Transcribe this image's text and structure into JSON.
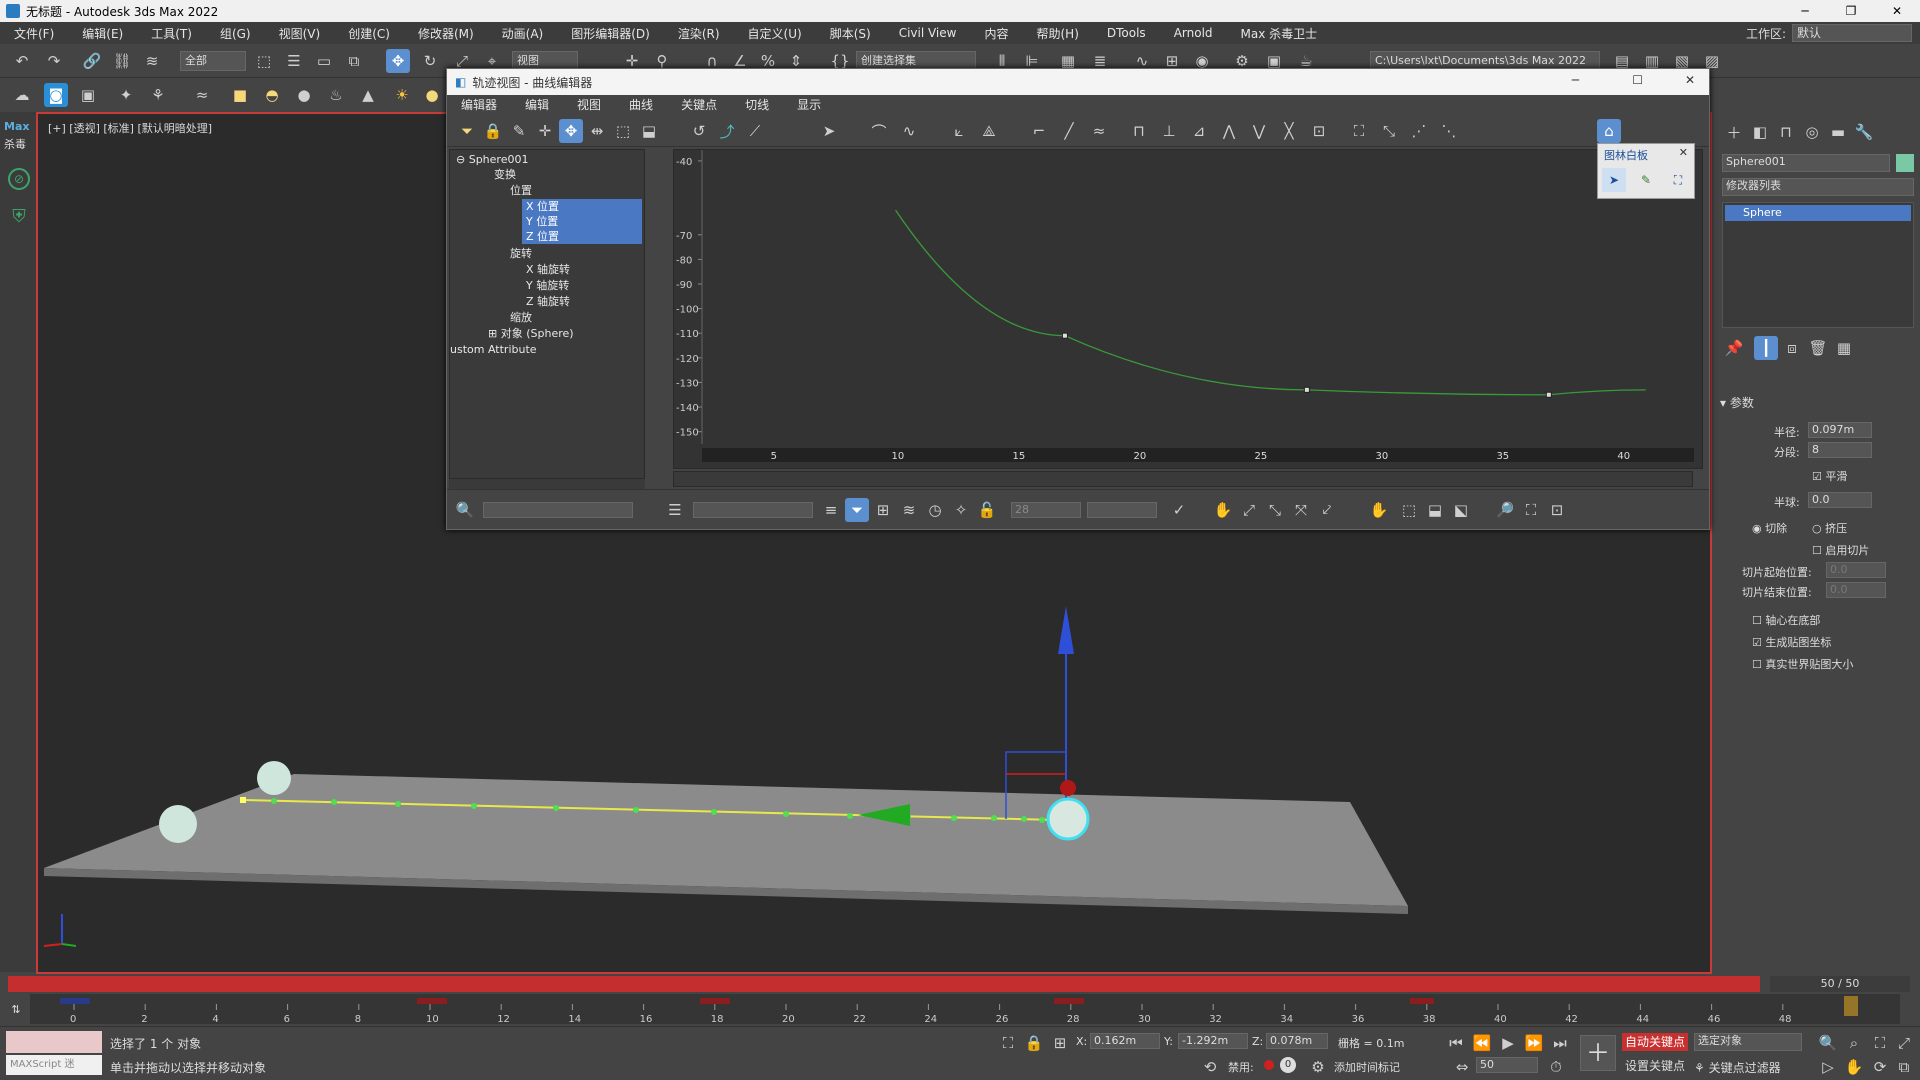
{
  "app": {
    "title": "无标题 - Autodesk 3ds Max 2022",
    "window_controls": [
      "─",
      "❐",
      "✕"
    ]
  },
  "menu": [
    "文件(F)",
    "编辑(E)",
    "工具(T)",
    "组(G)",
    "视图(V)",
    "创建(C)",
    "修改器(M)",
    "动画(A)",
    "图形编辑器(D)",
    "渲染(R)",
    "自定义(U)",
    "脚本(S)",
    "Civil View",
    "内容",
    "帮助(H)",
    "DTools",
    "Arnold",
    "Max 杀毒卫士"
  ],
  "workspace": {
    "label": "工作区:",
    "value": "默认"
  },
  "toolbar": {
    "selection_filter": "全部",
    "ref_coord": "视图",
    "named_selection": "创建选择集",
    "path": "C:\\Users\\lxt\\Documents\\3ds Max 2022"
  },
  "left_strip": {
    "logo_top": "Max",
    "logo_bottom": "杀毒"
  },
  "viewport": {
    "label": "[+] [透视] [标准] [默认明暗处理]",
    "axis_z": "z"
  },
  "trackview": {
    "title": "轨迹视图 - 曲线编辑器",
    "controls": [
      "─",
      "☐",
      "✕"
    ],
    "menu": [
      "编辑器",
      "编辑",
      "视图",
      "曲线",
      "关键点",
      "切线",
      "显示"
    ],
    "tree": {
      "root": "Sphere001",
      "transform": "变换",
      "position": "位置",
      "x_pos": "X 位置",
      "y_pos": "Y 位置",
      "z_pos": "Z 位置",
      "rotation": "旋转",
      "x_rot": "X 轴旋转",
      "y_rot": "Y 轴旋转",
      "z_rot": "Z 轴旋转",
      "scale": "缩放",
      "object": "对象 (Sphere)",
      "custom": "ustom Attribute"
    },
    "frame_field": "28"
  },
  "whiteboard": {
    "title": "图林白板"
  },
  "command_panel": {
    "object_name": "Sphere001",
    "modifier_list": "修改器列表",
    "stack_item": "Sphere",
    "rollout": "参数",
    "params": {
      "radius_label": "半径:",
      "radius_value": "0.097m",
      "segments_label": "分段:",
      "segments_value": "8",
      "smooth_label": "平滑",
      "hemisphere_label": "半球:",
      "hemisphere_value": "0.0",
      "chop_label": "切除",
      "squash_label": "挤压",
      "enable_slice_label": "启用切片",
      "slice_from_label": "切片起始位置:",
      "slice_from_value": "0.0",
      "slice_to_label": "切片结束位置:",
      "slice_to_value": "0.0",
      "base_to_pivot_label": "轴心在底部",
      "gen_map_label": "生成贴图坐标",
      "real_world_label": "真实世界贴图大小"
    }
  },
  "timeslider": {
    "value": "50 / 50"
  },
  "trackbar": {
    "ticks": [
      "0",
      "2",
      "4",
      "6",
      "8",
      "10",
      "12",
      "14",
      "16",
      "18",
      "20",
      "22",
      "24",
      "26",
      "28",
      "30",
      "32",
      "34",
      "36",
      "38",
      "40",
      "42",
      "44",
      "46",
      "48"
    ]
  },
  "status": {
    "selected": "选择了 1 个 对象",
    "hint": "单击并拖动以选择并移动对象",
    "maxscript": "MAXScript 迷",
    "x_label": "X:",
    "x_value": "0.162m",
    "y_label": "Y:",
    "y_value": "-1.292m",
    "z_label": "Z:",
    "z_value": "0.078m",
    "grid": "栅格 = 0.1m",
    "disable": "禁用:",
    "add_time_tag": "添加时间标记",
    "auto_key": "自动关键点",
    "set_key": "设置关键点",
    "selected_obj": "选定对象",
    "key_filters": "关键点过滤器",
    "frame": "50"
  },
  "chart_data": {
    "type": "line",
    "y_ticks": [
      "-40",
      "-70",
      "-80",
      "-90",
      "-100",
      "-110",
      "-120",
      "-130",
      "-140",
      "-150"
    ],
    "x_ticks": [
      "5",
      "10",
      "15",
      "20",
      "25",
      "30",
      "35",
      "40"
    ],
    "series": [
      {
        "x": [
          10,
          17,
          27,
          37,
          41
        ],
        "y": [
          -60,
          -111,
          -133,
          -135,
          -133
        ],
        "color": "#3a9a3a"
      }
    ],
    "keys": [
      {
        "x": 17,
        "y": -111
      },
      {
        "x": 27,
        "y": -133
      },
      {
        "x": 37,
        "y": -135
      }
    ]
  }
}
